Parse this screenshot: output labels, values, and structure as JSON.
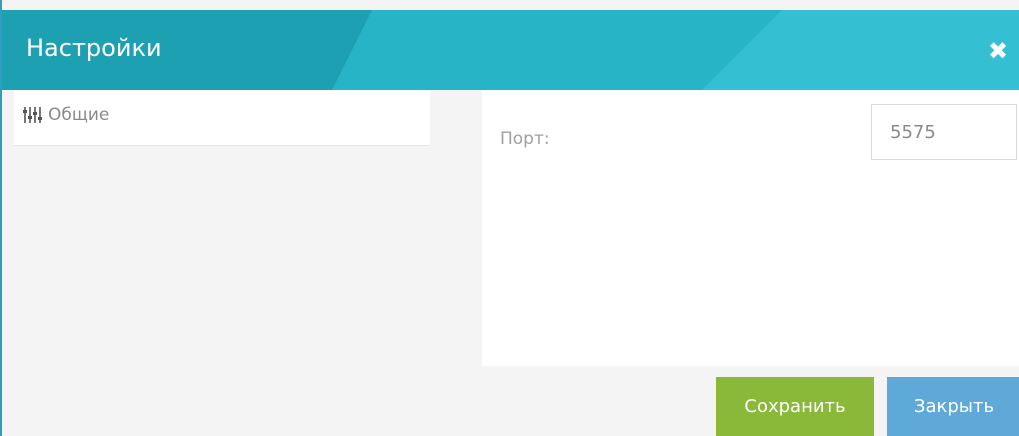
{
  "dialog": {
    "title": "Настройки",
    "close_icon": "close-icon"
  },
  "sidebar": {
    "items": [
      {
        "label": "Общие",
        "icon": "sliders-icon",
        "selected": true
      }
    ]
  },
  "settings": {
    "port_label": "Порт:",
    "port_value": "5575"
  },
  "footer": {
    "save_label": "Сохранить",
    "close_label": "Закрыть"
  },
  "colors": {
    "titlebar": "#1ea0b3",
    "save_button": "#8ab93a",
    "close_button": "#5ea9d7"
  }
}
